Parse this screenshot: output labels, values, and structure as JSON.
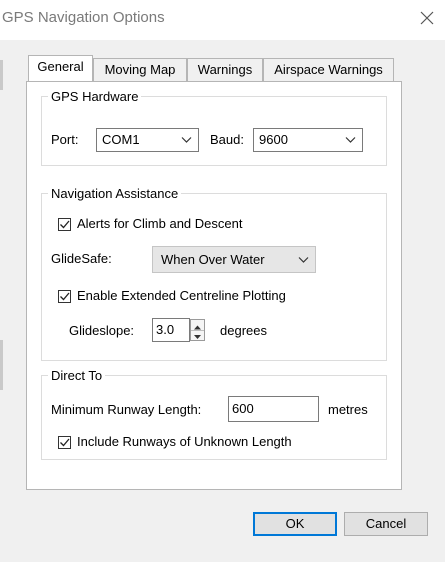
{
  "window": {
    "title": "GPS Navigation Options"
  },
  "tabs": [
    {
      "label": "General",
      "active": true
    },
    {
      "label": "Moving Map",
      "active": false
    },
    {
      "label": "Warnings",
      "active": false
    },
    {
      "label": "Airspace Warnings",
      "active": false
    }
  ],
  "gps_hardware": {
    "title": "GPS Hardware",
    "port_label": "Port:",
    "port_value": "COM1",
    "baud_label": "Baud:",
    "baud_value": "9600"
  },
  "navigation_assistance": {
    "title": "Navigation Assistance",
    "alerts_label": "Alerts for Climb and Descent",
    "alerts_checked": true,
    "glidesafe_label": "GlideSafe:",
    "glidesafe_value": "When Over Water",
    "centreline_label": "Enable Extended Centreline Plotting",
    "centreline_checked": true,
    "glideslope_label": "Glideslope:",
    "glideslope_value": "3.0",
    "glideslope_unit": "degrees"
  },
  "direct_to": {
    "title": "Direct To",
    "min_runway_label": "Minimum Runway Length:",
    "min_runway_value": "600",
    "min_runway_unit": "metres",
    "include_unknown_label": "Include Runways of Unknown Length",
    "include_unknown_checked": true
  },
  "buttons": {
    "ok": "OK",
    "cancel": "Cancel"
  },
  "colors": {
    "accent": "#0078d7",
    "window_bg": "#f0f0f0",
    "panel_bg": "#ffffff"
  }
}
